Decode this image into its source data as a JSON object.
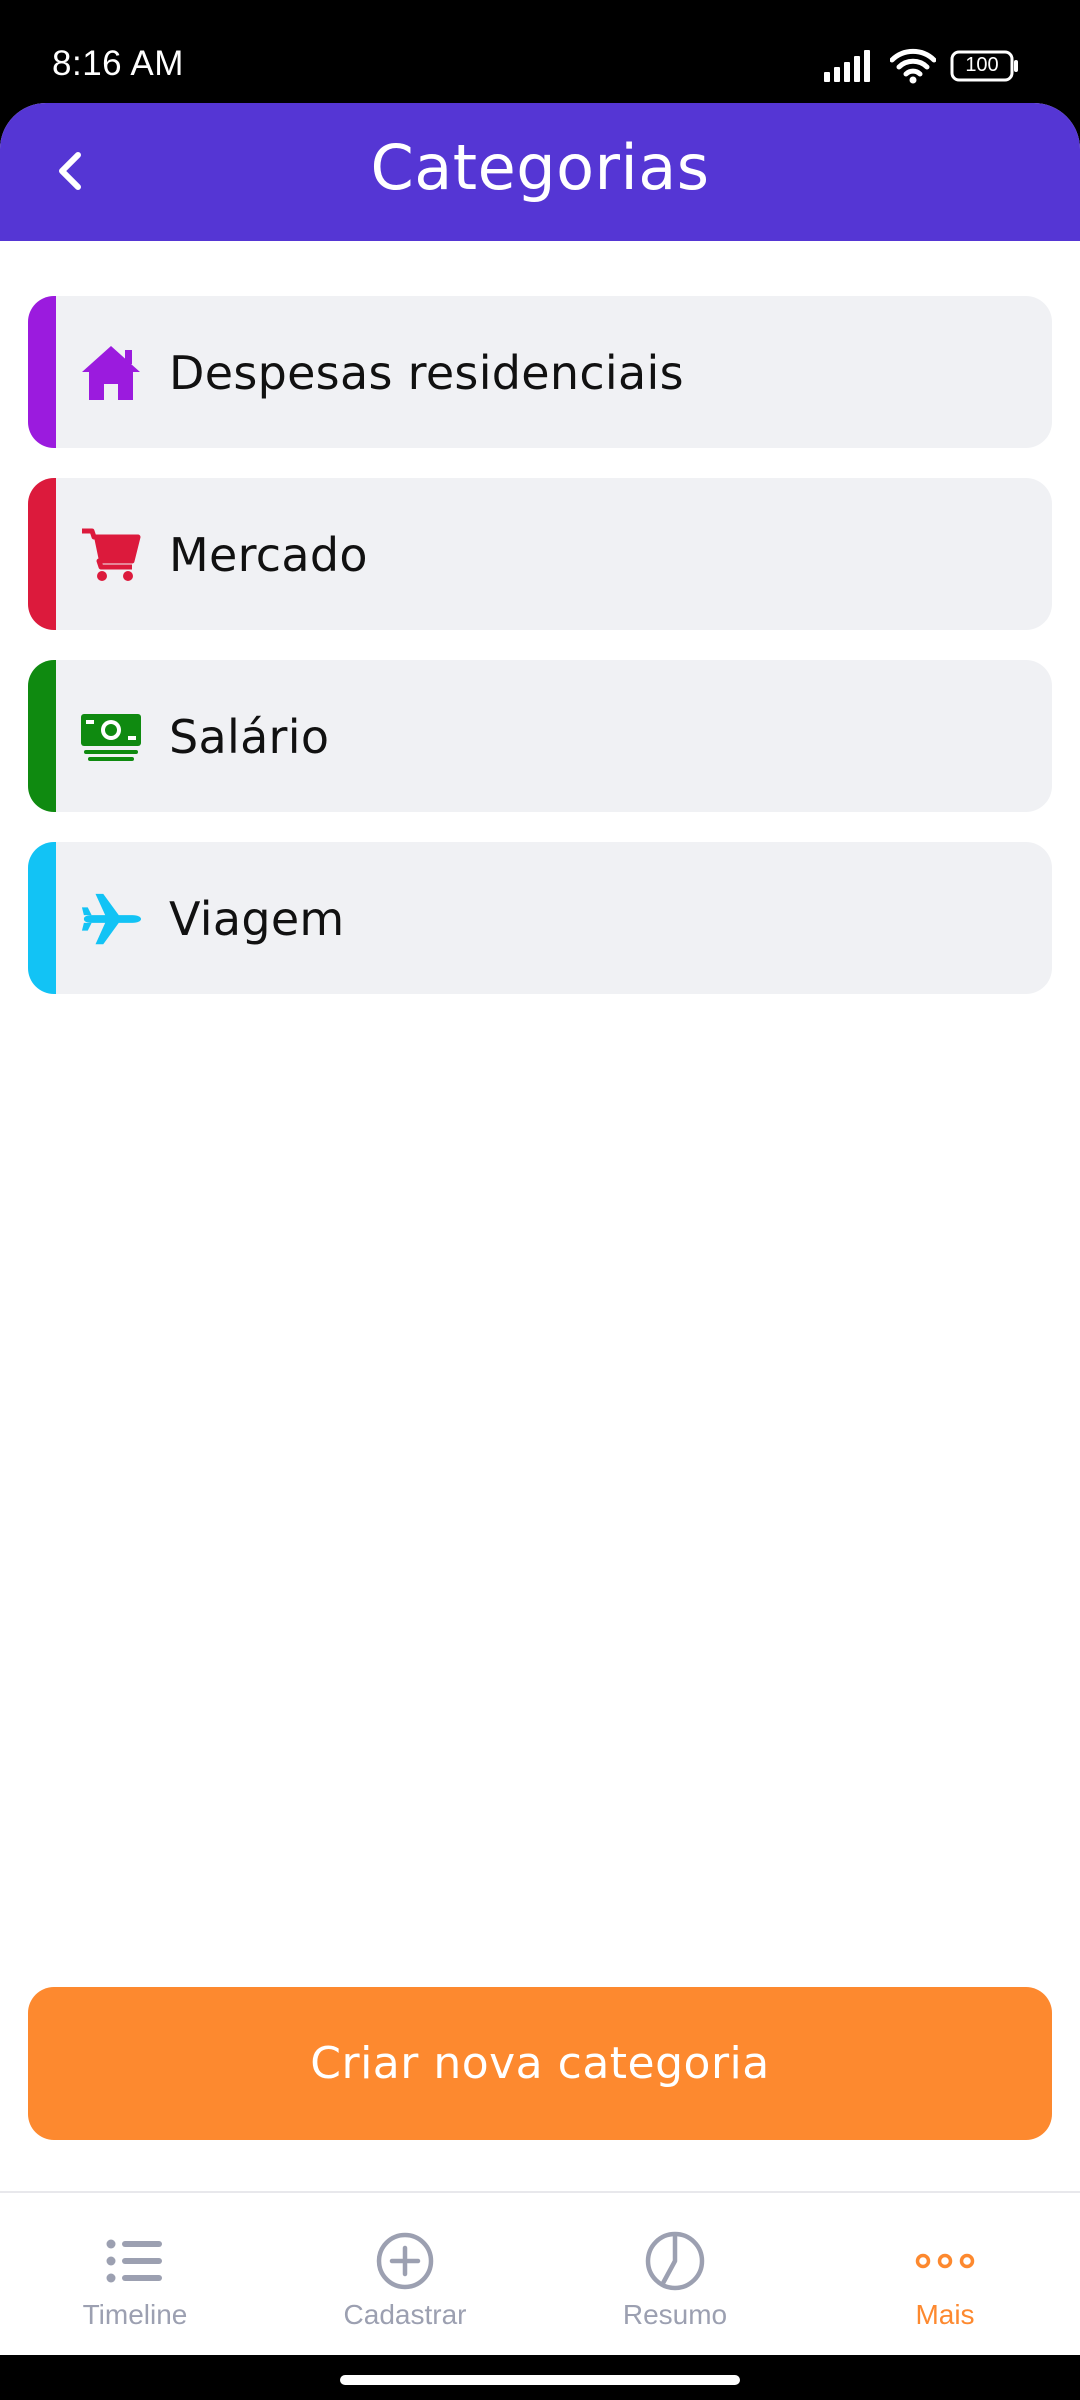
{
  "status_bar": {
    "time": "8:16 AM",
    "battery": "100",
    "icons": [
      "signal-icon",
      "wifi-icon",
      "battery-icon"
    ]
  },
  "header": {
    "title": "Categorias",
    "back_icon": "chevron-left-icon",
    "background": "#5536d4"
  },
  "categories": [
    {
      "label": "Despesas residenciais",
      "icon": "home-icon",
      "color": "#9b1bde"
    },
    {
      "label": "Mercado",
      "icon": "cart-icon",
      "color": "#dc1a3c"
    },
    {
      "label": "Salário",
      "icon": "money-icon",
      "color": "#0f8a10"
    },
    {
      "label": "Viagem",
      "icon": "plane-icon",
      "color": "#12c3f5"
    }
  ],
  "create_button": {
    "label": "Criar nova categoria",
    "color": "#fd892f"
  },
  "bottom_nav": {
    "items": [
      {
        "label": "Timeline",
        "icon": "list-icon",
        "active": false
      },
      {
        "label": "Cadastrar",
        "icon": "plus-circle-icon",
        "active": false
      },
      {
        "label": "Resumo",
        "icon": "pie-chart-icon",
        "active": false
      },
      {
        "label": "Mais",
        "icon": "more-dots-icon",
        "active": true
      }
    ],
    "active_color": "#fd892f",
    "inactive_color": "#9ca0b1"
  }
}
